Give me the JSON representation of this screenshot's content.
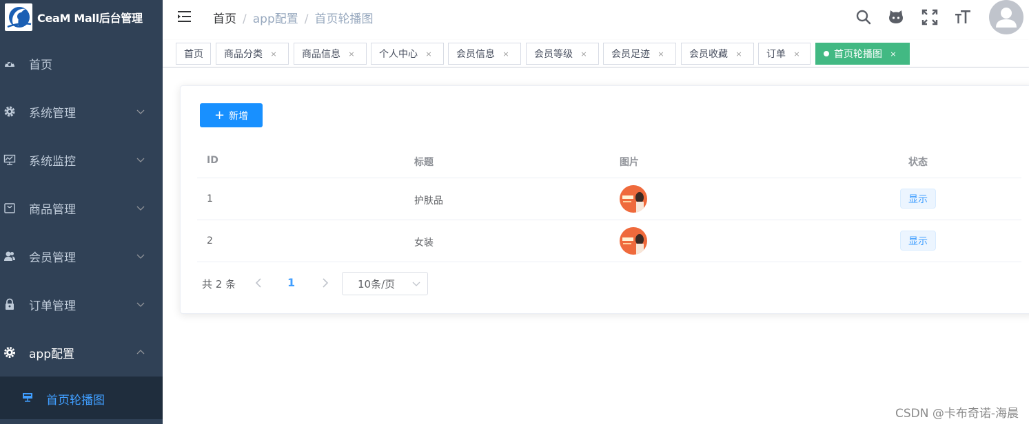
{
  "app": {
    "title": "CeaM Mall后台管理"
  },
  "sidebar": {
    "items": [
      {
        "label": "首页",
        "icon": "dashboard-icon"
      },
      {
        "label": "系统管理",
        "icon": "gear-icon"
      },
      {
        "label": "系统监控",
        "icon": "monitor-icon"
      },
      {
        "label": "商品管理",
        "icon": "shopping-icon"
      },
      {
        "label": "会员管理",
        "icon": "peoples-icon"
      },
      {
        "label": "订单管理",
        "icon": "lock-icon"
      },
      {
        "label": "app配置",
        "icon": "settings-icon"
      }
    ],
    "active_sub": {
      "label": "首页轮播图",
      "icon": "slideshow-icon"
    }
  },
  "navbar": {
    "breadcrumb": [
      "首页",
      "app配置",
      "首页轮播图"
    ],
    "icons": [
      "search-icon",
      "github-icon",
      "fullscreen-icon",
      "font-size-icon",
      "avatar"
    ]
  },
  "tags": [
    "首页",
    "商品分类",
    "商品信息",
    "个人中心",
    "会员信息",
    "会员等级",
    "会员足迹",
    "会员收藏",
    "订单",
    "首页轮播图"
  ],
  "toolbar": {
    "add_label": "新增"
  },
  "table": {
    "columns": [
      "ID",
      "标题",
      "图片",
      "状态"
    ],
    "rows": [
      {
        "id": "1",
        "title": "护肤品",
        "status": "显示"
      },
      {
        "id": "2",
        "title": "女装",
        "status": "显示"
      }
    ]
  },
  "pagination": {
    "total": "共 2 条",
    "current": "1",
    "page_size": "10条/页"
  },
  "watermark": "CSDN @卡布奇诺-海晨",
  "colors": {
    "sidebar_bg": "#304156",
    "primary": "#1890ff",
    "active_tag": "#42b983",
    "active_menu": "#409eff"
  }
}
